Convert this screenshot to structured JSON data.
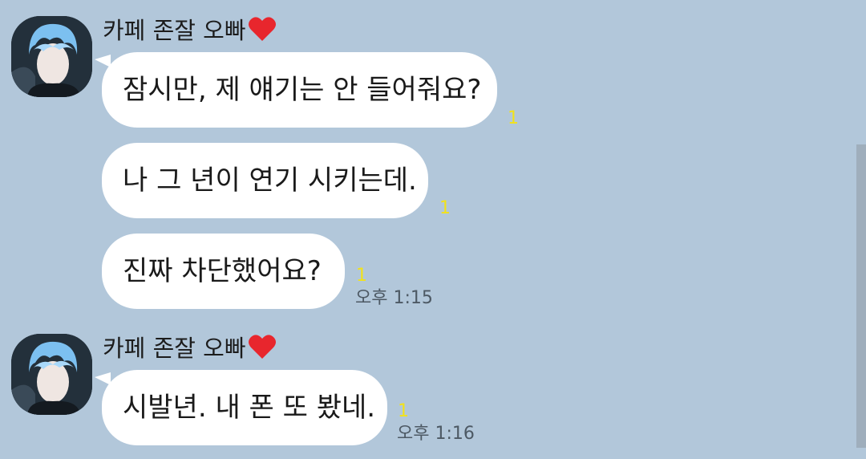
{
  "messages": [
    {
      "sender": "카페 존잘 오빠",
      "bubbles": [
        {
          "text": "잠시만, 제 얘기는 안 들어줘요?",
          "unread": "1"
        },
        {
          "text": "나 그 년이 연기 시키는데.",
          "unread": "1"
        },
        {
          "text": "진짜 차단했어요?",
          "unread": "1",
          "time": "오후 1:15"
        }
      ]
    },
    {
      "sender": "카페 존잘 오빠",
      "bubbles": [
        {
          "text": "시발년. 내 폰 또 봤네.",
          "unread": "1",
          "time": "오후 1:16"
        }
      ]
    }
  ],
  "icons": {
    "avatar": "profile-avatar-icon",
    "heart": "red-heart-icon"
  },
  "colors": {
    "background": "#b2c7da",
    "bubble": "#ffffff",
    "unread": "#f2e21a",
    "time": "#4d5964"
  }
}
